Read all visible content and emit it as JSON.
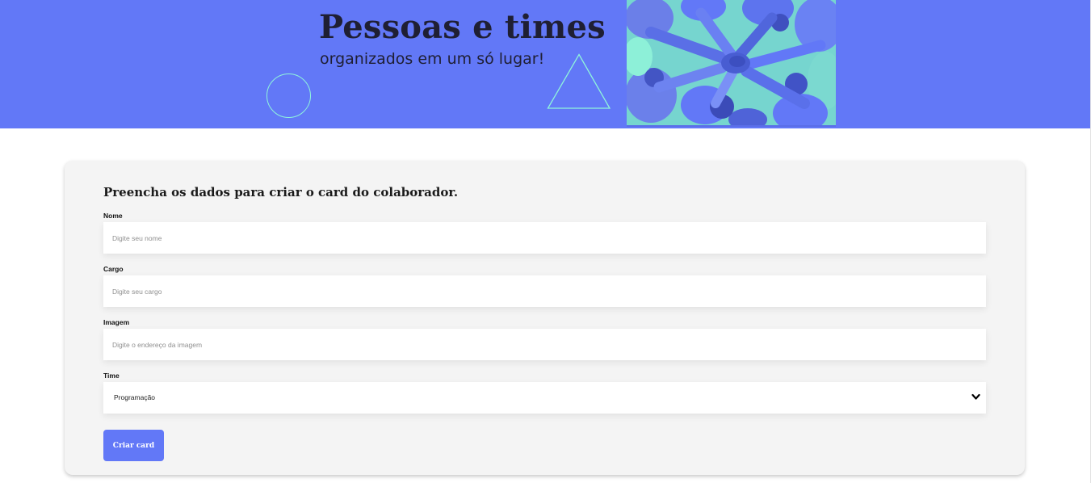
{
  "colors": {
    "brand": "#6278f7",
    "accent": "#8ff5dc",
    "card_bg": "#f4f4f4",
    "text_dark": "#1f1f33"
  },
  "banner": {
    "title": "Pessoas e times",
    "subtitle": "organizados em um só lugar!",
    "decorations": [
      "circle-outline",
      "triangle-outline"
    ],
    "photo": "hands-stacked-team-photo"
  },
  "form": {
    "heading": "Preencha os dados para criar o card do colaborador.",
    "fields": [
      {
        "label": "Nome",
        "placeholder": "Digite seu nome",
        "value": ""
      },
      {
        "label": "Cargo",
        "placeholder": "Digite seu cargo",
        "value": ""
      },
      {
        "label": "Imagem",
        "placeholder": "Digite o endereço da imagem",
        "value": ""
      }
    ],
    "team": {
      "label": "Time",
      "selected": "Programação"
    },
    "submit_label": "Criar card"
  }
}
